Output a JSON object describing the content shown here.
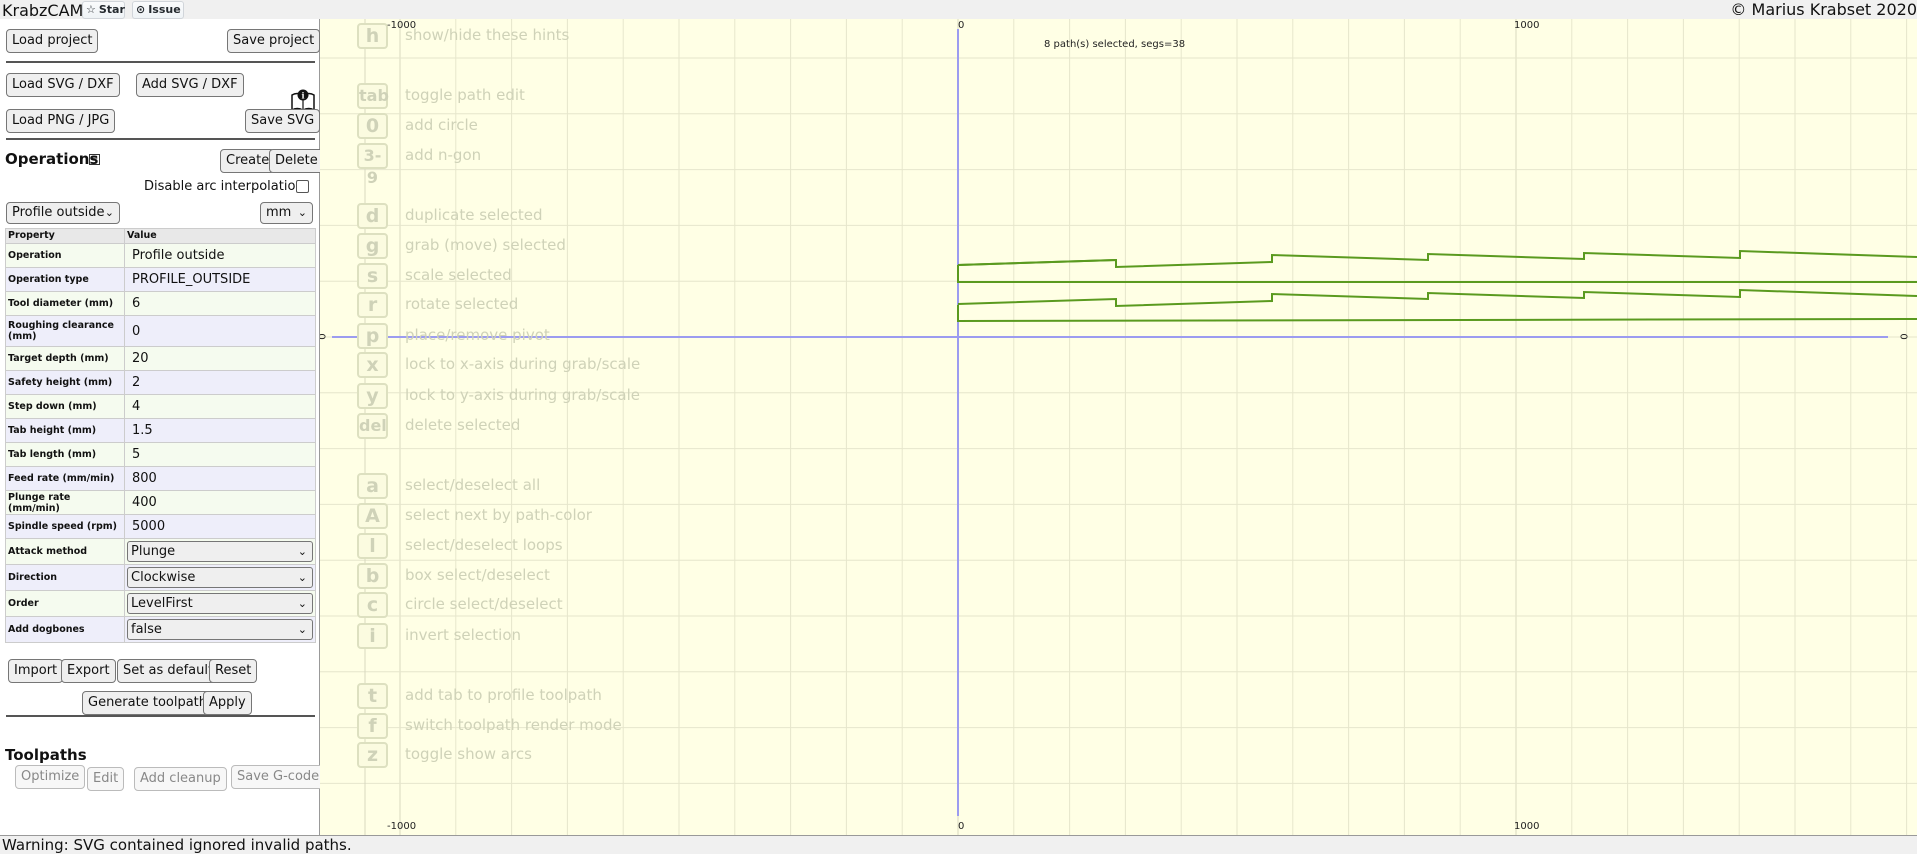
{
  "topbar": {
    "title": "KrabzCAM",
    "star_label": "Star",
    "issue_label": "Issue",
    "copyright": "© Marius Krabset 2020"
  },
  "left_panel": {
    "load_project": "Load project",
    "save_project": "Save project",
    "load_svg": "Load SVG / DXF",
    "add_svg": "Add SVG / DXF",
    "load_png": "Load PNG / JPG",
    "save_svg": "Save SVG",
    "operations_title": "Operations",
    "create": "Create",
    "delete": "Delete",
    "arc_label": "Disable arc interpolation",
    "operation_select": "Profile outside",
    "unit_select": "mm",
    "table_header": {
      "property": "Property",
      "value": "Value"
    },
    "properties": [
      {
        "name": "Operation",
        "value": "Profile outside"
      },
      {
        "name": "Operation type",
        "value": "PROFILE_OUTSIDE"
      },
      {
        "name": "Tool diameter (mm)",
        "value": "6"
      },
      {
        "name": "Roughing clearance (mm)",
        "value": "0"
      },
      {
        "name": "Target depth (mm)",
        "value": "20"
      },
      {
        "name": "Safety height (mm)",
        "value": "2"
      },
      {
        "name": "Step down (mm)",
        "value": "4"
      },
      {
        "name": "Tab height (mm)",
        "value": "1.5"
      },
      {
        "name": "Tab length (mm)",
        "value": "5"
      },
      {
        "name": "Feed rate (mm/min)",
        "value": "800"
      },
      {
        "name": "Plunge rate (mm/min)",
        "value": "400"
      },
      {
        "name": "Spindle speed (rpm)",
        "value": "5000"
      },
      {
        "name": "Attack method",
        "value": "Plunge"
      },
      {
        "name": "Direction",
        "value": "Clockwise"
      },
      {
        "name": "Order",
        "value": "LevelFirst"
      },
      {
        "name": "Add dogbones",
        "value": "false"
      }
    ],
    "import": "Import",
    "export": "Export",
    "set_default": "Set as default",
    "reset": "Reset",
    "generate": "Generate toolpath",
    "apply": "Apply",
    "toolpaths_title": "Toolpaths",
    "optimize": "Optimize",
    "edit": "Edit",
    "add_cleanup": "Add cleanup",
    "save_gcode": "Save G-code"
  },
  "canvas": {
    "selection_info": "8 path(s) selected, segs=38",
    "axis_labels": {
      "top_neg": "-1000",
      "top_zero": "0",
      "top_pos": "1000",
      "bottom_neg": "-1000",
      "bottom_zero": "0",
      "bottom_pos": "1000",
      "left_zero": "0",
      "right_zero": "0"
    },
    "hints": [
      {
        "key": "h",
        "desc": "show/hide these hints"
      },
      {
        "key": "tab",
        "desc": "toggle path edit"
      },
      {
        "key": "0",
        "desc": "add circle"
      },
      {
        "key": "3-9",
        "desc": "add n-gon"
      },
      {
        "key": "d",
        "desc": "duplicate selected"
      },
      {
        "key": "g",
        "desc": "grab (move) selected"
      },
      {
        "key": "s",
        "desc": "scale selected"
      },
      {
        "key": "r",
        "desc": "rotate selected"
      },
      {
        "key": "p",
        "desc": "place/remove pivot"
      },
      {
        "key": "x",
        "desc": "lock to x-axis during grab/scale"
      },
      {
        "key": "y",
        "desc": "lock to y-axis during grab/scale"
      },
      {
        "key": "del",
        "desc": "delete selected"
      },
      {
        "key": "a",
        "desc": "select/deselect all"
      },
      {
        "key": "A",
        "desc": "select next by path-color"
      },
      {
        "key": "l",
        "desc": "select/deselect loops"
      },
      {
        "key": "b",
        "desc": "box select/deselect"
      },
      {
        "key": "c",
        "desc": "circle select/deselect"
      },
      {
        "key": "i",
        "desc": "invert selection"
      },
      {
        "key": "t",
        "desc": "add tab to profile toolpath"
      },
      {
        "key": "f",
        "desc": "switch toolpath render mode"
      },
      {
        "key": "z",
        "desc": "toggle show arcs"
      }
    ],
    "colors": {
      "background": "#ffffe5",
      "axis": "#9c9cf0",
      "path": "#5a9a1f",
      "grid": "#e6e6cc"
    }
  },
  "status": {
    "message": "Warning: SVG contained ignored invalid paths."
  }
}
